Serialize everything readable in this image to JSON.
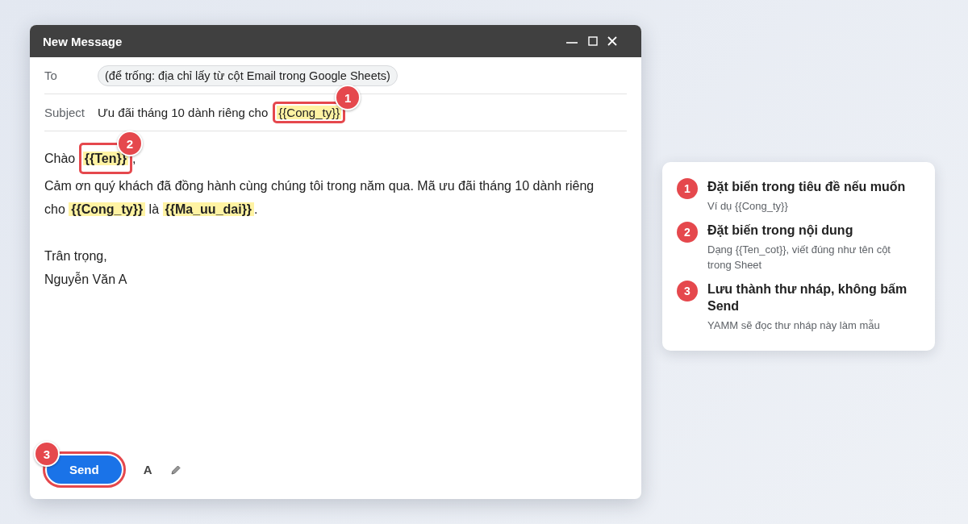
{
  "window": {
    "title": "New Message"
  },
  "to": {
    "label": "To",
    "chip": "(để trống: địa chỉ lấy từ cột Email trong Google Sheets)"
  },
  "subject": {
    "label": "Subject",
    "segments": [
      {
        "kind": "text",
        "text": "Ưu đãi tháng 10 dành riêng cho"
      },
      {
        "kind": "variable",
        "text": "{{Cong_ty}}",
        "callout": "1"
      }
    ]
  },
  "body": [
    {
      "segments": [
        {
          "kind": "text",
          "text": "Chào "
        },
        {
          "kind": "variable",
          "text": "{{Ten}}",
          "callout": "2"
        },
        {
          "kind": "text",
          "text": ","
        }
      ]
    },
    {
      "paragraph": "Cảm ơn quý khách đã đồng hành cùng chúng tôi trong năm qua. Mã ưu đãi tháng 10 dành riêng cho **{{Cong_ty}}** là **{{Ma_uu_dai}}**."
    },
    {
      "blank_before": true,
      "segments": [
        {
          "kind": "text",
          "text": "Trân trọng,"
        }
      ]
    },
    {
      "segments": [
        {
          "kind": "text",
          "text": "Nguyễn Văn A"
        }
      ]
    }
  ],
  "footer": {
    "send": {
      "label": "Send",
      "callout": "3"
    },
    "format_icon": "A"
  },
  "guide": [
    {
      "number": "1",
      "title": "Đặt biến trong tiêu đề nếu muốn",
      "note": "Ví dụ {{Cong_ty}}"
    },
    {
      "number": "2",
      "title": "Đặt biến trong nội dung",
      "note": "Dạng {{Ten_cot}}, viết đúng như tên cột trong Sheet"
    },
    {
      "number": "3",
      "title": "Lưu thành thư nháp, không bấm Send",
      "note": "YAMM sẽ đọc thư nháp này làm mẫu"
    }
  ]
}
